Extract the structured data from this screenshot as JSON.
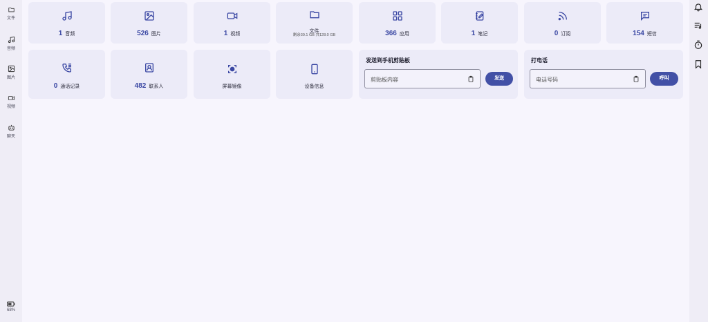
{
  "left_nav": [
    {
      "icon": "folder-icon",
      "label": "文件"
    },
    {
      "icon": "music-note-icon",
      "label": "音频"
    },
    {
      "icon": "image-icon",
      "label": "图片"
    },
    {
      "icon": "video-icon",
      "label": "视频"
    },
    {
      "icon": "robot-chat-icon",
      "label": "聊天"
    }
  ],
  "battery": {
    "icon": "battery-icon",
    "label": "68%"
  },
  "right_toolbar": [
    "bell-icon",
    "playlist-icon",
    "timer-icon",
    "bookmark-icon"
  ],
  "stats": [
    {
      "icon": "music-note-icon",
      "count": "1",
      "label": "音频"
    },
    {
      "icon": "image-icon",
      "count": "526",
      "label": "图片"
    },
    {
      "icon": "video-icon",
      "count": "1",
      "label": "视频"
    },
    {
      "icon": "folder-icon",
      "count": "",
      "label": "文件",
      "sub": "剩余39.1 GB 共128.0 GB"
    },
    {
      "icon": "apps-grid-icon",
      "count": "366",
      "label": "应用"
    },
    {
      "icon": "notebook-icon",
      "count": "1",
      "label": "笔记"
    },
    {
      "icon": "rss-icon",
      "count": "0",
      "label": "订阅"
    },
    {
      "icon": "message-icon",
      "count": "154",
      "label": "短信"
    }
  ],
  "tools": [
    {
      "icon": "call-log-icon",
      "count": "0",
      "label": "通话记录"
    },
    {
      "icon": "contact-icon",
      "count": "482",
      "label": "联系人"
    },
    {
      "icon": "screen-mirror-icon",
      "count": "",
      "label": "屏幕镜像"
    },
    {
      "icon": "phone-device-icon",
      "count": "",
      "label": "设备信息"
    }
  ],
  "clipboard": {
    "title": "发送到手机剪贴板",
    "placeholder": "剪贴板内容",
    "button": "发送"
  },
  "call": {
    "title": "打电话",
    "placeholder": "电话号码",
    "button": "呼叫"
  },
  "colors": {
    "accent": "#4250a6",
    "card": "#ecebf8",
    "background": "#f7f5fd"
  }
}
